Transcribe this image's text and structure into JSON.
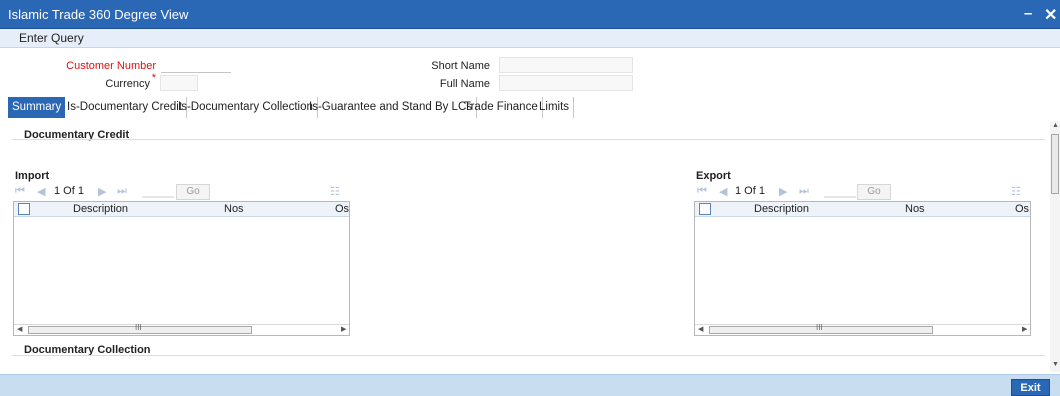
{
  "window": {
    "title": "Islamic Trade 360 Degree View",
    "min_symbol": "–",
    "close_symbol": "✕"
  },
  "menu": {
    "enter_query": "Enter Query"
  },
  "form": {
    "customer_number_label": "Customer Number",
    "required_mark": "*",
    "currency_label": "Currency",
    "short_name_label": "Short Name",
    "full_name_label": "Full Name",
    "customer_number_value": "",
    "currency_value": "",
    "short_name_value": "",
    "full_name_value": ""
  },
  "tabs": [
    {
      "label": "Summary",
      "active": true
    },
    {
      "label": "Is-Documentary Credit",
      "active": false
    },
    {
      "label": "Is-Documentary Collection",
      "active": false
    },
    {
      "label": "Is-Guarantee and Stand By LCs",
      "active": false
    },
    {
      "label": "Trade Finance",
      "active": false
    },
    {
      "label": "Limits",
      "active": false
    }
  ],
  "sections": {
    "documentary_credit": "Documentary Credit",
    "documentary_collection": "Documentary Collection"
  },
  "grids": {
    "import": {
      "title": "Import",
      "page_text": "1 Of 1",
      "go_label": "Go",
      "columns": [
        "Description",
        "Nos",
        "Os"
      ]
    },
    "export": {
      "title": "Export",
      "page_text": "1 Of 1",
      "go_label": "Go",
      "columns": [
        "Description",
        "Nos",
        "Os"
      ]
    }
  },
  "pager_icons": {
    "first": "⏮",
    "prev": "◀",
    "next": "▶",
    "last": "⏭",
    "columns": "☷"
  },
  "scroll_grip": "III",
  "footer": {
    "exit_label": "Exit"
  }
}
